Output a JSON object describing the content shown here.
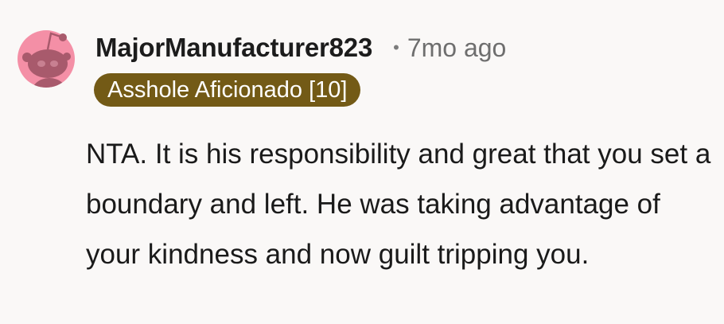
{
  "comment": {
    "username": "MajorManufacturer823",
    "separator": "•",
    "timestamp": "7mo ago",
    "flair": "Asshole Aficionado [10]",
    "body": "NTA. It is his responsibility and great that you set a boundary and left. He was taking advantage of your kindness and now guilt tripping you."
  },
  "avatar": {
    "icon": "snoo-avatar-icon",
    "background_color": "#f48fa6",
    "figure_color": "#a85a6c"
  },
  "colors": {
    "flair_background": "#735a16",
    "flair_text": "#ffffff",
    "page_background": "#faf8f7",
    "username": "#1c1c1c",
    "timestamp": "#6e6e6e"
  }
}
